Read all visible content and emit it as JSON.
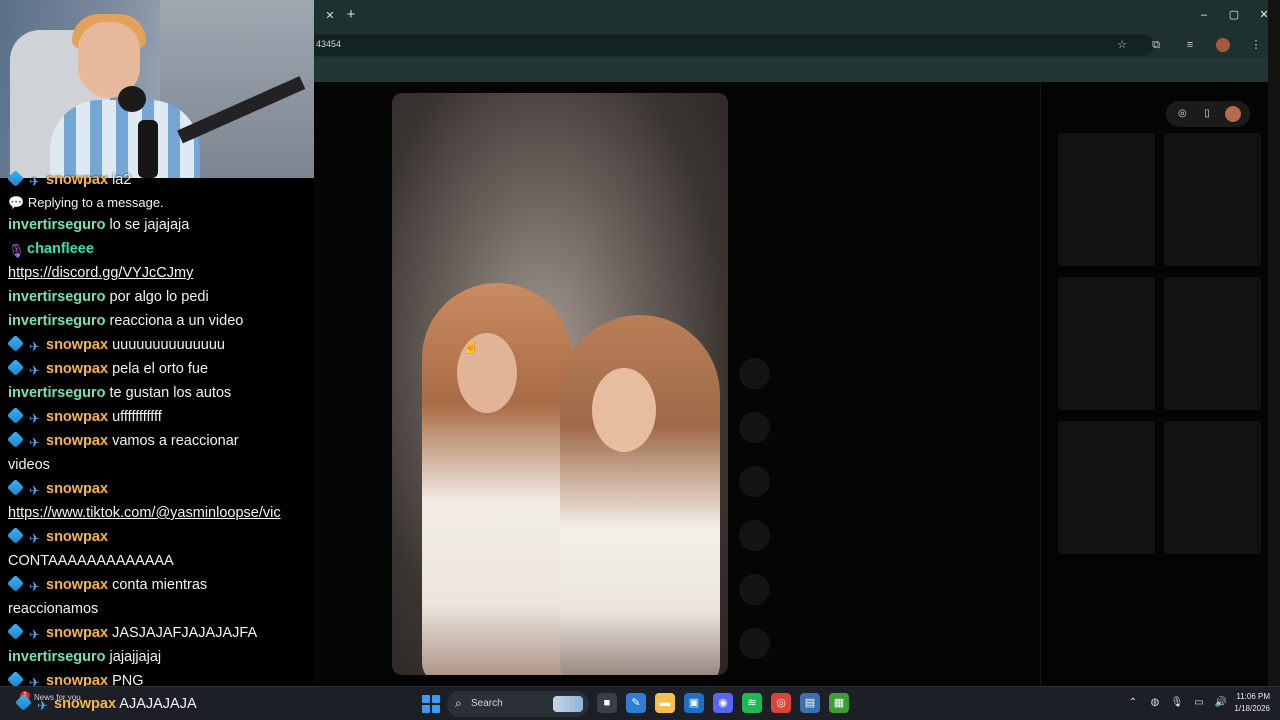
{
  "browser": {
    "url": "43454",
    "tab_close": "✕",
    "new_tab": "+",
    "window_controls": [
      "–",
      "▢",
      "✕"
    ],
    "address_icons": [
      "star-icon",
      "extensions-icon",
      "media-icon",
      "profile-icon",
      "menu-icon"
    ]
  },
  "chat": {
    "messages": [
      {
        "badges": [
          "cube",
          "tool"
        ],
        "user": "snowpax",
        "user_color": "#f7b54a",
        "text": "la2"
      },
      {
        "type": "reply",
        "text": "Replying to a message."
      },
      {
        "badges": [],
        "user": "invertirseguro",
        "user_color": "#6fe3b3",
        "text": "lo se jajajaja"
      },
      {
        "badges": [
          "mic"
        ],
        "user": "chanfleee",
        "user_color": "#2de3b0",
        "text": ""
      },
      {
        "type": "link",
        "text": "https://discord.gg/VYJcCJmy"
      },
      {
        "badges": [],
        "user": "invertirseguro",
        "user_color": "#6fe3b3",
        "text": "por algo lo pedi"
      },
      {
        "badges": [],
        "user": "invertirseguro",
        "user_color": "#6fe3b3",
        "text": "reacciona a un video"
      },
      {
        "badges": [
          "cube",
          "tool"
        ],
        "user": "snowpax",
        "user_color": "#f7b54a",
        "text": "uuuuuuuuuuuuuu"
      },
      {
        "badges": [
          "cube",
          "tool"
        ],
        "user": "snowpax",
        "user_color": "#f7b54a",
        "text": "pela el orto fue"
      },
      {
        "badges": [],
        "user": "invertirseguro",
        "user_color": "#6fe3b3",
        "text": "te gustan los autos"
      },
      {
        "badges": [
          "cube",
          "tool"
        ],
        "user": "snowpax",
        "user_color": "#f7b54a",
        "text": "ufffffffffff"
      },
      {
        "badges": [
          "cube",
          "tool"
        ],
        "user": "snowpax",
        "user_color": "#f7b54a",
        "text": "vamos a reaccionar"
      },
      {
        "type": "plain",
        "text": "videos"
      },
      {
        "badges": [
          "cube",
          "tool"
        ],
        "user": "snowpax",
        "user_color": "#f7b54a",
        "text": ""
      },
      {
        "type": "link",
        "text": "https://www.tiktok.com/@yasminloopse/vic"
      },
      {
        "badges": [
          "cube",
          "tool"
        ],
        "user": "snowpax",
        "user_color": "#f7b54a",
        "text": ""
      },
      {
        "type": "plain",
        "text": "CONTAAAAAAAAAAAAA"
      },
      {
        "badges": [
          "cube",
          "tool"
        ],
        "user": "snowpax",
        "user_color": "#f7b54a",
        "text": "conta mientras"
      },
      {
        "type": "plain",
        "text": "reaccionamos"
      },
      {
        "badges": [
          "cube",
          "tool"
        ],
        "user": "snowpax",
        "user_color": "#f7b54a",
        "text": "JASJAJAFJAJAJAJFA"
      },
      {
        "badges": [],
        "user": "invertirseguro",
        "user_color": "#6fe3b3",
        "text": "jajajjajaj"
      },
      {
        "badges": [
          "cube",
          "tool"
        ],
        "user": "snowpax",
        "user_color": "#f7b54a",
        "text": "PNG"
      }
    ],
    "overlay": {
      "user": "snowpax",
      "text": "AJAJAJAJA"
    }
  },
  "side_panel": {
    "icons": [
      "compass-icon",
      "phone-icon",
      "avatar"
    ]
  },
  "taskbar": {
    "news_badge": "1",
    "news_text": "News for you",
    "search_placeholder": "Search",
    "time": "11:06 PM",
    "date": "1/18/2026",
    "apps": [
      {
        "name": "file-explorer-icon",
        "color": "#3a3f47",
        "glyph": "■"
      },
      {
        "name": "paint-icon",
        "color": "#2d7fd8",
        "glyph": "✎"
      },
      {
        "name": "folder-icon",
        "color": "#f2c14e",
        "glyph": "▬"
      },
      {
        "name": "store-icon",
        "color": "#1f6fc5",
        "glyph": "▣"
      },
      {
        "name": "discord-icon",
        "color": "#5865f2",
        "glyph": "◉"
      },
      {
        "name": "spotify-icon",
        "color": "#1db954",
        "glyph": "≋"
      },
      {
        "name": "chrome-icon",
        "color": "#db4437",
        "glyph": "◎"
      },
      {
        "name": "app-icon",
        "color": "#3b6fb0",
        "glyph": "▤"
      },
      {
        "name": "minecraft-icon",
        "color": "#3f9c35",
        "glyph": "▦"
      }
    ]
  }
}
